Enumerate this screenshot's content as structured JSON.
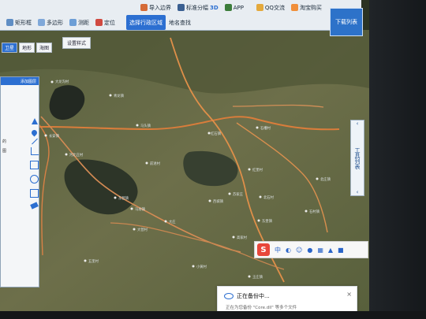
{
  "toolbar": {
    "row1_items": [
      "导入边界",
      "标准分幅",
      "3D",
      "APP"
    ],
    "search_buttons": [
      "QQ交流",
      "淘宝购买"
    ],
    "map_list_label": "下载列表"
  },
  "toolbar2": {
    "items": [
      "矩形框",
      "多边形",
      "测距",
      "定位"
    ],
    "region_select_label": "选择行政区域",
    "landmark_label": "地名查找"
  },
  "left_tabs": [
    "卫星",
    "地形",
    "海图"
  ],
  "style_button_label": "设置样式",
  "layer_panel": {
    "header": "添加图层",
    "text_lines": [
      "的",
      "图"
    ]
  },
  "tool_strip": {
    "label": "工具列表"
  },
  "ime": {
    "logo": "S",
    "lang": "中"
  },
  "backup_toast": {
    "title": "正在备份中...",
    "subtitle": "正在为您备份 \"Core.dll\" 等多个文件"
  },
  "map_labels": [
    "大龙沟村",
    "青龙镇",
    "长安镇",
    "马头镇",
    "红石镇",
    "石槽村",
    "红堡村",
    "河北庄村",
    "前进村",
    "东营镇",
    "马坊镇",
    "苏家庄",
    "西城镇",
    "北石村",
    "石村镇",
    "北庄镇",
    "大庄",
    "东堡镇",
    "三义庄",
    "高家村",
    "小黄村",
    "王庄镇",
    "大营村",
    "南营",
    "五里村"
  ],
  "colors": {
    "accent": "#2c6fd1",
    "road": "#e08a43",
    "map_base": "#3f4a30"
  }
}
